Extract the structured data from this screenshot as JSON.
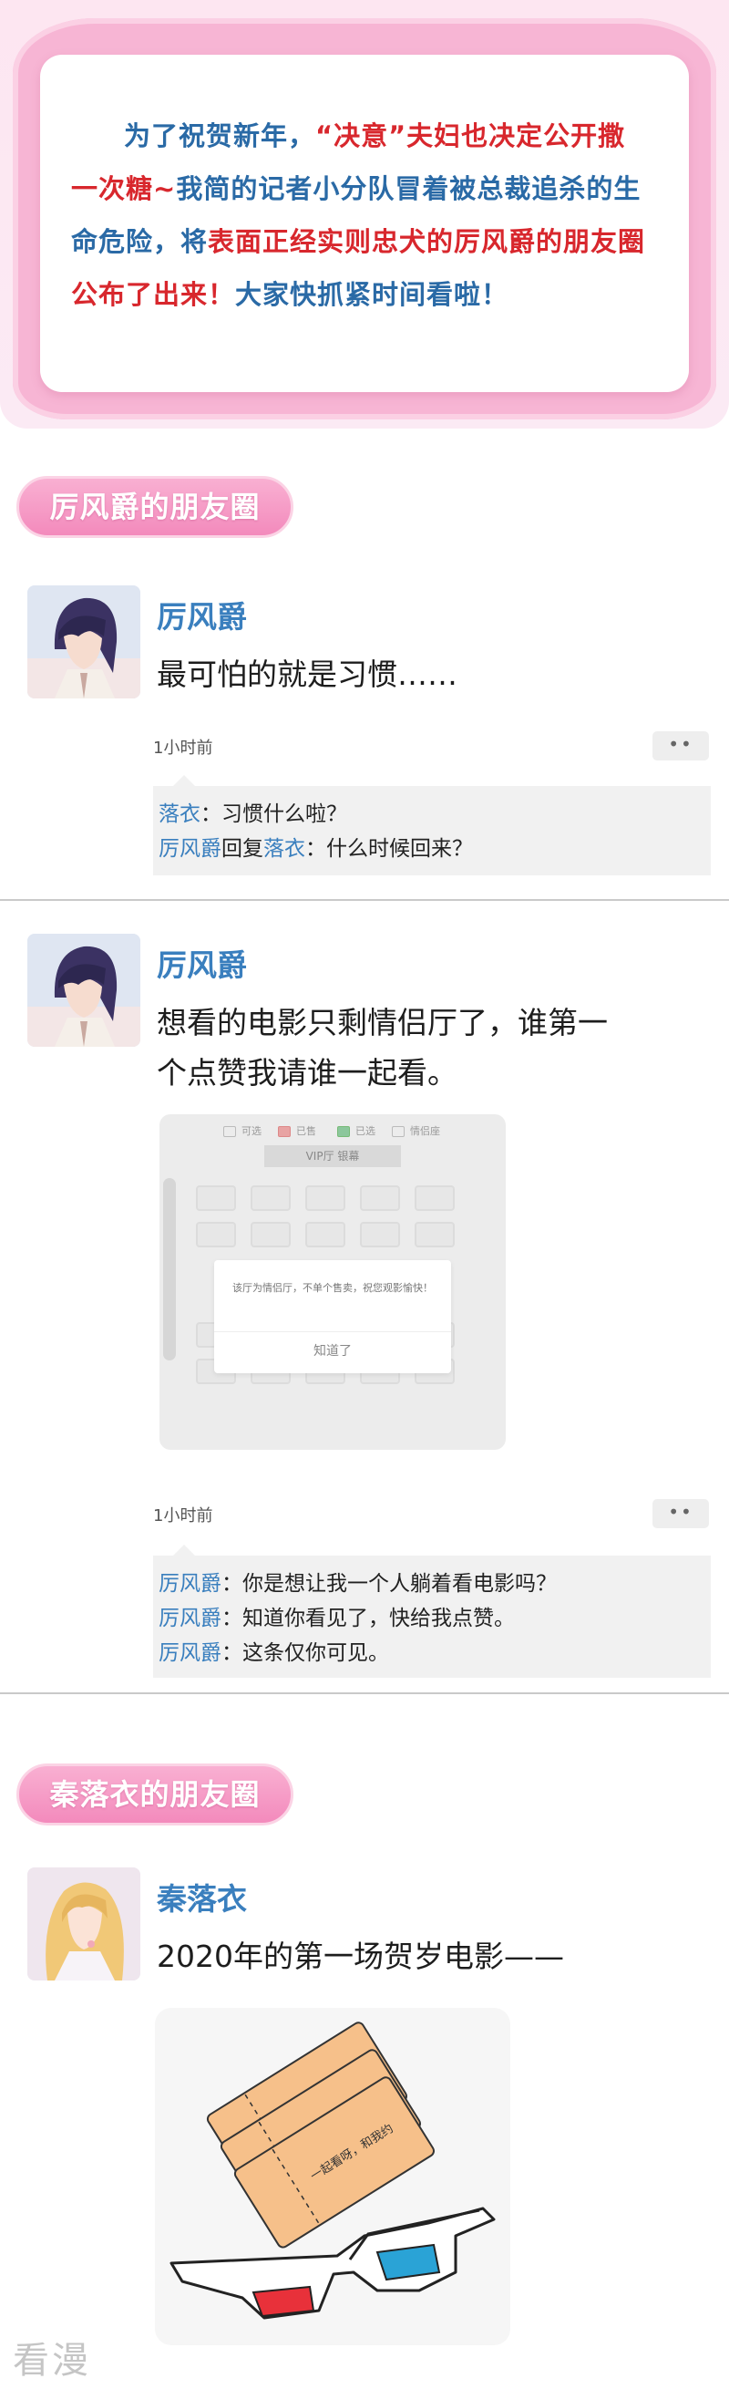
{
  "intro": {
    "line1_a": "为了祝贺新年，",
    "line1_b": "“决意”",
    "line1_c": "夫妇也决定公开撒",
    "line2_a": "一次糖~",
    "line2_b": "我简的记者小分队冒着被总裁追杀的生",
    "line3_a": "命危险，将",
    "line3_b": "表面正经实则忠犬的厉风爵的朋友圈",
    "line4_a": "公布了出来！",
    "line4_b": "大家快抓紧时间看啦！"
  },
  "sections": {
    "section1_title": "厉风爵的朋友圈",
    "section2_title": "秦落衣的朋友圈"
  },
  "posts": [
    {
      "name": "厉风爵",
      "text": "最可怕的就是习惯……",
      "time": "1小时前",
      "more": "••",
      "comments": [
        {
          "name": "落衣",
          "sep": "：",
          "text": "习惯什么啦？"
        },
        {
          "name": "厉风爵",
          "mid": "回复",
          "name2": "落衣",
          "sep": "：",
          "text": "什么时候回来？"
        }
      ]
    },
    {
      "name": "厉风爵",
      "text_line1": "想看的电影只剩情侣厅了，谁第一",
      "text_line2": "个点赞我请谁一起看。",
      "time": "1小时前",
      "more": "••",
      "comments": [
        {
          "name": "厉风爵",
          "sep": "：",
          "text": "你是想让我一个人躺着看电影吗？"
        },
        {
          "name": "厉风爵",
          "sep": "：",
          "text": "知道你看见了，快给我点赞。"
        },
        {
          "name": "厉风爵",
          "sep": "：",
          "text": "这条仅你可见。"
        }
      ]
    },
    {
      "name": "秦落衣",
      "text": "2020年的第一场贺岁电影——"
    }
  ],
  "cinema": {
    "legend": [
      "可选",
      "已售",
      "已选",
      "情侣座"
    ],
    "hall_title": "VIP厅 银幕",
    "dialog_msg": "该厅为情侣厅，不单个售卖，祝您观影愉快！",
    "dialog_btn": "知道了"
  },
  "ticket_text": "一起看呀，和我约",
  "watermark": "看漫"
}
